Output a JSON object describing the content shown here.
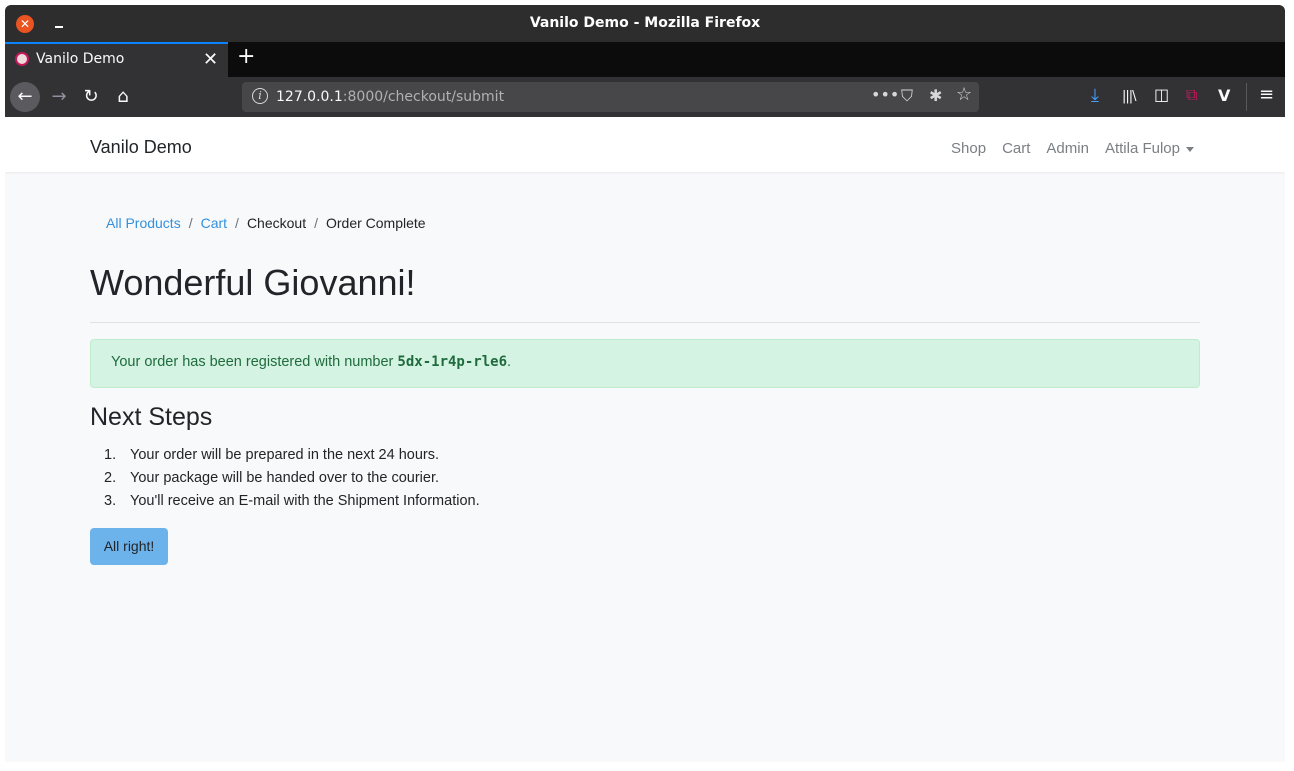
{
  "window": {
    "title": "Vanilo Demo - Mozilla Firefox",
    "close_symbol": "✕",
    "minimize_symbol": ""
  },
  "tabs": [
    {
      "label": "Vanilo Demo",
      "close_symbol": "✕"
    }
  ],
  "newtab_symbol": "+",
  "toolbar": {
    "back_icon": "←",
    "forward_icon": "→",
    "reload_icon": "↻",
    "home_icon": "⌂",
    "url_host": "127.0.0.1",
    "url_rest": ":8000/checkout/submit",
    "more_icon": "•••",
    "pocket_icon": "⛉",
    "bug_icon": "✱",
    "star_icon": "☆",
    "download_icon": "⤓",
    "library_icon": "|||\\",
    "sidebar_icon": "◫",
    "containers_icon": "⧉",
    "vue_icon": "V",
    "menu_icon": "≡"
  },
  "site": {
    "brand": "Vanilo Demo",
    "menu": [
      {
        "label": "Shop"
      },
      {
        "label": "Cart"
      },
      {
        "label": "Admin"
      },
      {
        "label": "Attila Fulop"
      }
    ]
  },
  "breadcrumb": [
    {
      "label": "All Products",
      "link": true
    },
    {
      "label": "Cart",
      "link": true
    },
    {
      "label": "Checkout",
      "link": false
    },
    {
      "label": "Order Complete",
      "link": false
    }
  ],
  "breadcrumb_separator": "/",
  "heading": "Wonderful Giovanni!",
  "alert": {
    "text_before": "Your order has been registered with number ",
    "order_number": "5dx-1r4p-rle6",
    "text_after": "."
  },
  "next_steps": {
    "title": "Next Steps",
    "items": [
      {
        "num": "1.",
        "text": "Your order will be prepared in the next 24 hours."
      },
      {
        "num": "2.",
        "text": "Your package will be handed over to the courier."
      },
      {
        "num": "3.",
        "text": "You'll receive an E-mail with the Shipment Information."
      }
    ]
  },
  "button": {
    "label": "All right!"
  },
  "colors": {
    "link": "#3490dc",
    "alert_bg": "#d4f3e2",
    "alert_text": "#1f6b3d",
    "button_bg": "#6cb2eb",
    "firefox_accent": "#0a84ff",
    "ubuntu_close": "#e95420"
  }
}
